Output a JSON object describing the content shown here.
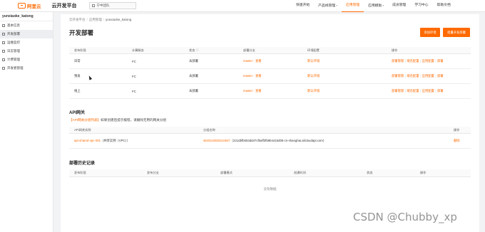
{
  "header": {
    "logo_text": "阿里云",
    "platform_title": "云开发平台",
    "org_select": "宁中团队",
    "nav": [
      {
        "label": "快速开始",
        "caret": false
      },
      {
        "label": "产品线管理",
        "caret": true
      },
      {
        "label": "应用管理",
        "caret": false
      },
      {
        "label": "应用模板",
        "caret": true
      },
      {
        "label": "成员管理",
        "caret": false
      },
      {
        "label": "学习中心",
        "caret": false
      },
      {
        "label": "帮助文档",
        "caret": false
      }
    ],
    "active_nav": "应用管理",
    "accent": "#ff6a00"
  },
  "sidebar": {
    "app_name": "yunxiaoke_katong",
    "items": [
      {
        "label": "基本信息",
        "icon": "info-icon"
      },
      {
        "label": "开发部署",
        "icon": "deploy-icon"
      },
      {
        "label": "运维监控",
        "icon": "monitor-icon"
      },
      {
        "label": "日志管理",
        "icon": "log-icon"
      },
      {
        "label": "计费管理",
        "icon": "billing-icon"
      },
      {
        "label": "开发者管理",
        "icon": "developer-icon"
      }
    ],
    "active_index": 1
  },
  "main": {
    "breadcrumb": [
      "云开发平台",
      "应用管理",
      "yunxiaoke_katong"
    ],
    "title": "开发部署",
    "add_button": "添加环境",
    "batch_button": "批量开发部署",
    "env_table": {
      "columns": [
        "发布阶段",
        "计算服务",
        "状态",
        "部署分支",
        "环境配置",
        "操作"
      ],
      "rows": [
        {
          "stage": "日常",
          "compute": "FC",
          "status": "未部署",
          "branch": "master · 查看",
          "config": "默认环境",
          "ops": [
            "部署管理",
            "域名配置",
            "应用配置",
            "部署"
          ]
        },
        {
          "stage": "预发",
          "compute": "FC",
          "status": "未部署",
          "branch": "master · 查看",
          "config": "默认环境",
          "ops": [
            "部署管理",
            "域名配置",
            "应用配置",
            "部署"
          ]
        },
        {
          "stage": "线上",
          "compute": "FC",
          "status": "未部署",
          "branch": "master · 查看",
          "config": "默认环境",
          "ops": [
            "部署管理",
            "域名配置",
            "应用配置",
            "部署"
          ]
        }
      ]
    },
    "api_section": {
      "title": "API网关",
      "note_link": "【API网关分组列表】",
      "note_text": "如果创建后提示报错，请删除无用的网关分组",
      "columns": [
        "API网关实例",
        "分组名称",
        "操作"
      ],
      "rows": [
        {
          "instance": "api-shared-vpc-001",
          "instance_suffix": "（共享实例（VPC））",
          "group": "sk20210820210627",
          "group_domain": "（221dbfb053dd47cf5aff3f59b4415d05-cn-shanghai.alicloudapi.com）",
          "op": "删除"
        }
      ]
    },
    "history_section": {
      "title": "部署历史记录",
      "columns": [
        "发布阶段",
        "发布分支",
        "部署模式",
        "创建时间",
        "状态",
        "操作"
      ],
      "empty_text": "没有数据"
    }
  },
  "watermark": "CSDN @Chubby_xp"
}
